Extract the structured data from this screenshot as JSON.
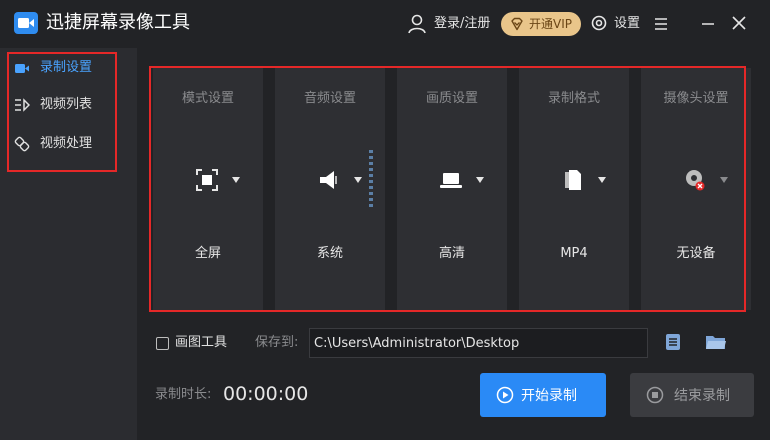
{
  "app": {
    "title": "迅捷屏幕录像工具"
  },
  "titlebar": {
    "login_label": "登录/注册",
    "vip_label": "开通VIP",
    "settings_label": "设置"
  },
  "sidebar": {
    "items": [
      {
        "label": "录制设置",
        "icon": "video-camera-icon",
        "active": true
      },
      {
        "label": "视频列表",
        "icon": "video-list-icon",
        "active": false
      },
      {
        "label": "视频处理",
        "icon": "video-edit-icon",
        "active": false
      }
    ]
  },
  "cards": [
    {
      "title": "模式设置",
      "value": "全屏",
      "icon": "fullscreen-icon"
    },
    {
      "title": "音频设置",
      "value": "系统",
      "icon": "speaker-icon"
    },
    {
      "title": "画质设置",
      "value": "高清",
      "icon": "laptop-icon"
    },
    {
      "title": "录制格式",
      "value": "MP4",
      "icon": "file-format-icon"
    },
    {
      "title": "摄像头设置",
      "value": "无设备",
      "icon": "webcam-off-icon"
    }
  ],
  "options": {
    "draw_tool_label": "画图工具",
    "draw_tool_checked": false,
    "save_label": "保存到:",
    "save_path": "C:\\Users\\Administrator\\Desktop"
  },
  "recording": {
    "duration_label": "录制时长:",
    "duration_value": "00:00:00",
    "start_label": "开始录制",
    "stop_label": "结束录制"
  },
  "colors": {
    "accent": "#2a8af6",
    "active_text": "#4aa3ff",
    "vip": "#e9c58a",
    "highlight_box": "#e52828"
  }
}
